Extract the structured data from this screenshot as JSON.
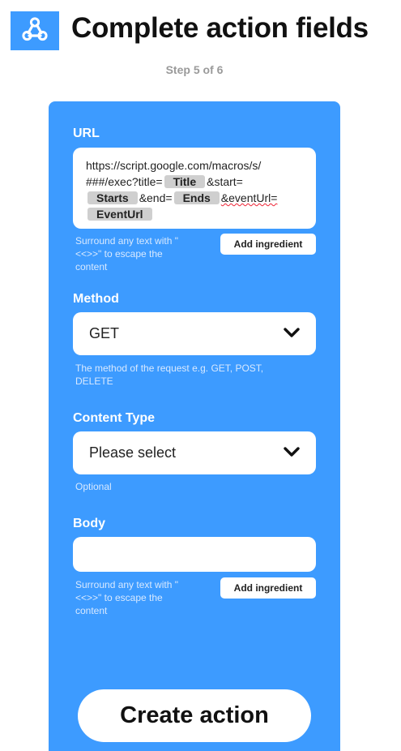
{
  "header": {
    "title": "Complete action fields",
    "step": "Step 5 of 6",
    "logo_icon": "webhooks-icon",
    "logo_color": "#3d9bff"
  },
  "form": {
    "background": "#3d9bff",
    "url": {
      "label": "URL",
      "text_1": "https://script.google.com/macros/s/",
      "text_2": "###/exec?title=",
      "ingredient_title": "Title",
      "text_3": "&start=",
      "ingredient_starts": "Starts",
      "text_4": "&end=",
      "ingredient_ends": "Ends",
      "text_5": "&eventUrl=",
      "ingredient_eventurl": "EventUrl",
      "helper_line_1": "Surround any text with \"",
      "helper_line_2": "<<>>\" to escape the",
      "helper_line_3": "content",
      "add_ingredient_label": "Add ingredient"
    },
    "method": {
      "label": "Method",
      "value": "GET",
      "helper_line_1": "The method of the request e.g. GET, POST,",
      "helper_line_2": "DELETE"
    },
    "content_type": {
      "label": "Content Type",
      "value": "Please select",
      "helper": "Optional"
    },
    "body": {
      "label": "Body",
      "value": "",
      "helper_line_1": "Surround any text with \"",
      "helper_line_2": "<<>>\" to escape the",
      "helper_line_3": "content",
      "add_ingredient_label": "Add ingredient"
    },
    "submit_label": "Create action"
  }
}
